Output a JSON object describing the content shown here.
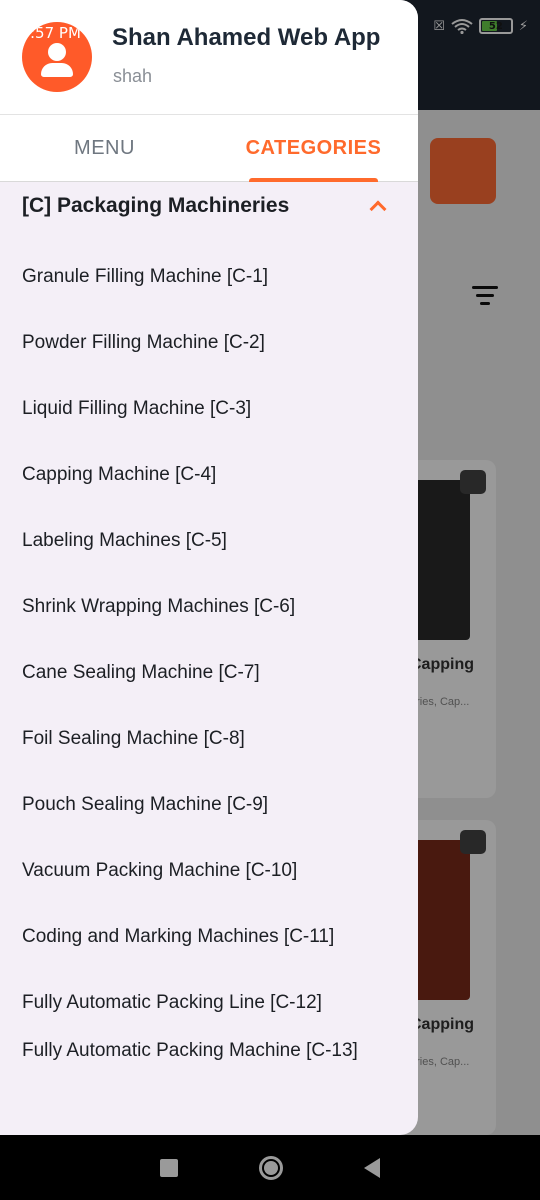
{
  "status_bar": {
    "time": ":57 PM",
    "battery": "52"
  },
  "drawer": {
    "app_name": "Shan Ahamed Web App",
    "user_name": "shah",
    "tabs": [
      {
        "label": "MENU",
        "active": false
      },
      {
        "label": "CATEGORIES",
        "active": true
      }
    ],
    "category": {
      "title": "[C] Packaging Machineries",
      "items": [
        "Granule Filling Machine [C-1]",
        "Powder Filling Machine [C-2]",
        "Liquid Filling Machine [C-3]",
        "Capping Machine [C-4]",
        "Labeling Machines [C-5]",
        "Shrink Wrapping Machines [C-6]",
        "Cane Sealing Machine [C-7]",
        "Foil Sealing Machine [C-8]",
        "Pouch Sealing Machine [C-9]",
        "Vacuum Packing Machine [C-10]",
        "Coding and Marking Machines [C-11]",
        "Fully Automatic Packing Line [C-12]",
        "Fully Automatic Packing Machine [C-13]"
      ]
    }
  },
  "background": {
    "cards": [
      {
        "title": "Capping",
        "subtitle": "eries, Cap..."
      },
      {
        "title": "Capping",
        "subtitle": "eries, Cap..."
      }
    ]
  },
  "colors": {
    "accent": "#ff6a2c",
    "drawer_bg": "#f4eff7",
    "topbar": "#1f2733"
  }
}
